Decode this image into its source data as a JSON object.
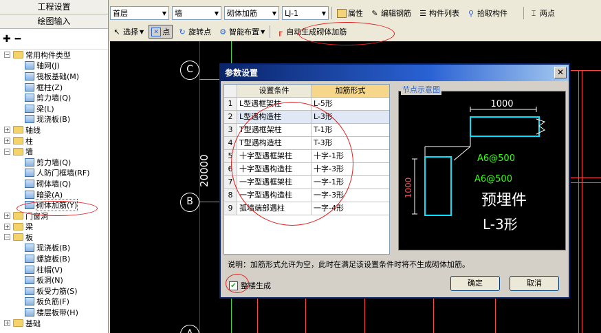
{
  "left_panel": {
    "header1": "工程设置",
    "header2": "绘图输入",
    "tree": [
      {
        "label": "常用构件类型",
        "level": 0,
        "type": "folder",
        "expanded": true
      },
      {
        "label": "轴网(J)",
        "level": 1,
        "type": "item"
      },
      {
        "label": "筏板基础(M)",
        "level": 1,
        "type": "item"
      },
      {
        "label": "框柱(Z)",
        "level": 1,
        "type": "item"
      },
      {
        "label": "剪力墙(Q)",
        "level": 1,
        "type": "item"
      },
      {
        "label": "梁(L)",
        "level": 1,
        "type": "item"
      },
      {
        "label": "现浇板(B)",
        "level": 1,
        "type": "item"
      },
      {
        "label": "轴线",
        "level": 0,
        "type": "folder",
        "expanded": false
      },
      {
        "label": "柱",
        "level": 0,
        "type": "folder",
        "expanded": false
      },
      {
        "label": "墙",
        "level": 0,
        "type": "folder",
        "expanded": true
      },
      {
        "label": "剪力墙(Q)",
        "level": 1,
        "type": "item"
      },
      {
        "label": "人防门框墙(RF)",
        "level": 1,
        "type": "item"
      },
      {
        "label": "砌体墙(Q)",
        "level": 1,
        "type": "item"
      },
      {
        "label": "暗梁(A)",
        "level": 1,
        "type": "item"
      },
      {
        "label": "砌体加筋(Y)",
        "level": 1,
        "type": "item",
        "selected": true
      },
      {
        "label": "门窗洞",
        "level": 0,
        "type": "folder",
        "expanded": false
      },
      {
        "label": "梁",
        "level": 0,
        "type": "folder",
        "expanded": false
      },
      {
        "label": "板",
        "level": 0,
        "type": "folder",
        "expanded": true
      },
      {
        "label": "现浇板(B)",
        "level": 1,
        "type": "item"
      },
      {
        "label": "螺旋板(B)",
        "level": 1,
        "type": "item"
      },
      {
        "label": "柱帽(V)",
        "level": 1,
        "type": "item"
      },
      {
        "label": "板洞(N)",
        "level": 1,
        "type": "item"
      },
      {
        "label": "板受力筋(S)",
        "level": 1,
        "type": "item"
      },
      {
        "label": "板负筋(F)",
        "level": 1,
        "type": "item"
      },
      {
        "label": "楼层板带(H)",
        "level": 1,
        "type": "item"
      },
      {
        "label": "基础",
        "level": 0,
        "type": "folder",
        "expanded": false
      }
    ]
  },
  "toolbar1": {
    "floor": "首层",
    "category": "墙",
    "component_type": "砌体加筋",
    "component": "LJ-1",
    "properties": "属性",
    "edit_rebar": "编辑钢筋",
    "component_list": "构件列表",
    "pick_component": "拾取构件",
    "two_points": "两点"
  },
  "toolbar2": {
    "select": "选择",
    "point": "点",
    "rotate_point": "旋转点",
    "smart_layout": "智能布置",
    "auto_generate": "自动生成砌体加筋"
  },
  "canvas": {
    "axis_c": "C",
    "axis_b": "B",
    "axis_a": "A",
    "dimension": "20000"
  },
  "dialog": {
    "title": "参数设置",
    "col_condition": "设置条件",
    "col_form": "加筋形式",
    "rows": [
      {
        "no": "1",
        "condition": "L型遇框架柱",
        "form": "L-5形"
      },
      {
        "no": "2",
        "condition": "L型遇构造柱",
        "form": "L-3形"
      },
      {
        "no": "3",
        "condition": "T型遇框架柱",
        "form": "T-1形"
      },
      {
        "no": "4",
        "condition": "T型遇构造柱",
        "form": "T-3形"
      },
      {
        "no": "5",
        "condition": "十字型遇框架柱",
        "form": "十字-1形"
      },
      {
        "no": "6",
        "condition": "十字型遇构造柱",
        "form": "十字-3形"
      },
      {
        "no": "7",
        "condition": "一字型遇框架柱",
        "form": "一字-1形"
      },
      {
        "no": "8",
        "condition": "一字型遇构造柱",
        "form": "一字-3形"
      },
      {
        "no": "9",
        "condition": "孤墙端部遇柱",
        "form": "一字-4形"
      }
    ],
    "preview_label": "节点示意图",
    "preview": {
      "dim_top": "1000",
      "dim_left": "1000",
      "rebar1": "A6@500",
      "rebar2": "A6@500",
      "caption1": "预埋件",
      "caption2": "L-3形"
    },
    "note": "说明：加筋形式允许为空，此时在满足该设置条件时将不生成砌体加筋。",
    "whole_building": "整楼生成",
    "ok": "确定",
    "cancel": "取消"
  },
  "colors": {
    "accent_red": "#e02020",
    "title_bar": "#0a246a",
    "drawing_cyan": "#00e5ff",
    "drawing_green": "#39ff14"
  }
}
